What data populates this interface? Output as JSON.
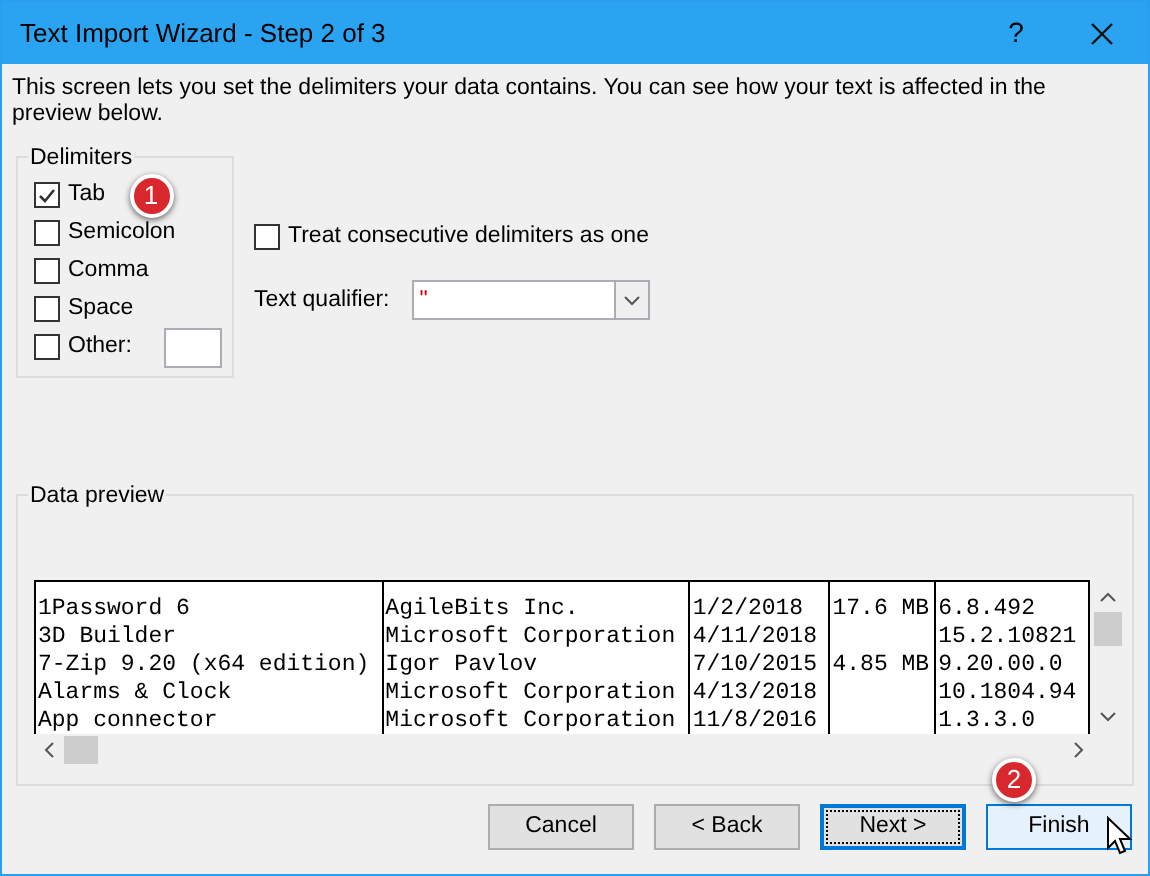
{
  "window": {
    "title": "Text Import Wizard - Step 2 of 3",
    "help": "?"
  },
  "description": "This screen lets you set the delimiters your data contains.  You can see how your text is affected in the preview below.",
  "delimiters": {
    "title": "Delimiters",
    "items": [
      {
        "label": "Tab",
        "checked": true,
        "kind": "check"
      },
      {
        "label": "Semicolon",
        "checked": false,
        "kind": "check"
      },
      {
        "label": "Comma",
        "checked": false,
        "kind": "check"
      },
      {
        "label": "Space",
        "checked": false,
        "kind": "check"
      },
      {
        "label": "Other:",
        "checked": false,
        "kind": "other"
      }
    ]
  },
  "treat_consecutive": {
    "label": "Treat consecutive delimiters as one",
    "checked": false
  },
  "text_qualifier": {
    "label": "Text qualifier:",
    "value": "\""
  },
  "data_preview": {
    "title": "Data preview",
    "rows": [
      [
        "1Password 6",
        "AgileBits Inc.",
        "1/2/2018",
        "17.6 MB",
        "6.8.492"
      ],
      [
        "3D Builder",
        "Microsoft Corporation",
        "4/11/2018",
        null,
        "15.2.10821"
      ],
      [
        "7-Zip 9.20 (x64 edition)",
        "Igor Pavlov",
        "7/10/2015",
        "4.85 MB",
        "9.20.00.0"
      ],
      [
        "Alarms & Clock",
        "Microsoft Corporation",
        "4/13/2018",
        null,
        "10.1804.94"
      ],
      [
        "App connector",
        "Microsoft Corporation",
        "11/8/2016",
        null,
        "1.3.3.0"
      ]
    ]
  },
  "callouts": [
    "1",
    "2"
  ],
  "buttons": [
    {
      "label": "Cancel",
      "selected": false
    },
    {
      "label": "< Back",
      "selected": false
    },
    {
      "label": "Next >",
      "selected": true
    },
    {
      "label": "Finish",
      "selected": false
    }
  ]
}
